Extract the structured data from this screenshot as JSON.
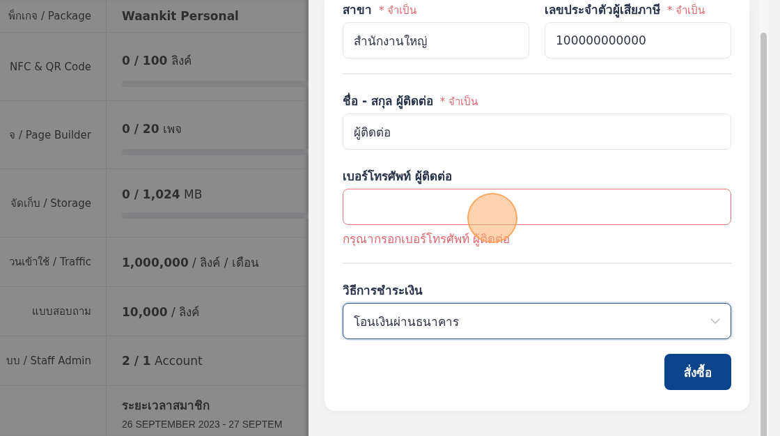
{
  "plan_table": {
    "rows": [
      {
        "kind": "title",
        "label": "พ็กเกจ / Package",
        "value": "Waankit Personal"
      },
      {
        "kind": "usage",
        "label": "NFC & QR Code",
        "value": "**0 / 100** ลิงค์",
        "level": 0
      },
      {
        "kind": "usage",
        "label": "จ / Page Builder",
        "value": "**0 / 20** เพจ",
        "level": 0
      },
      {
        "kind": "usage",
        "label": "จัดเก็บ / Storage",
        "value": "**0 / 1,024** MB",
        "level": 0
      },
      {
        "kind": "text",
        "label": "วนเข้าใช้ / Traffic",
        "value": "**1,000,000** / ลิงค์ / เดือน"
      },
      {
        "kind": "text",
        "label": "แบบสอบถาม",
        "value": "**10,000** / ลิงค์"
      },
      {
        "kind": "text",
        "label": "บบ / Staff Admin",
        "value": "**2 / 1** Account"
      },
      {
        "kind": "period",
        "heading": "ระยะเวลาสมาชิก",
        "value": "26 SEPTEMBER 2023 - 27 SEPTEM"
      }
    ]
  },
  "order_form": {
    "sections": [
      {
        "fields": [
          {
            "kind": "text",
            "label": "สาขา",
            "required_note": "* จำเป็น",
            "value": "สำนักงานใหญ่",
            "invalid": false,
            "focused": false
          },
          {
            "kind": "text",
            "label": "เลขประจำตัวผู้เสียภาษี",
            "required_note": "* จำเป็น",
            "value": "100000000000",
            "invalid": false,
            "focused": false
          }
        ]
      },
      {
        "fields": [
          {
            "kind": "text",
            "label": "ชื่อ - สกุล ผู้ติดต่อ",
            "required_note": "* จำเป็น",
            "value": "ผู้ติดต่อ",
            "invalid": false,
            "focused": false
          },
          {
            "kind": "text",
            "label": "เบอร์โทรศัพท์ ผู้ติดต่อ",
            "error": "กรุณากรอกเบอร์โทรศัพท์ ผู้ติดต่อ",
            "invalid": true,
            "focused": false
          }
        ]
      },
      {
        "fields": [
          {
            "kind": "select",
            "label": "วิธีการชำระเงิน",
            "value": "โอนเงินผ่านธนาคาร",
            "focused": true
          }
        ]
      }
    ],
    "submit_button": "สั่งซื้อ"
  }
}
